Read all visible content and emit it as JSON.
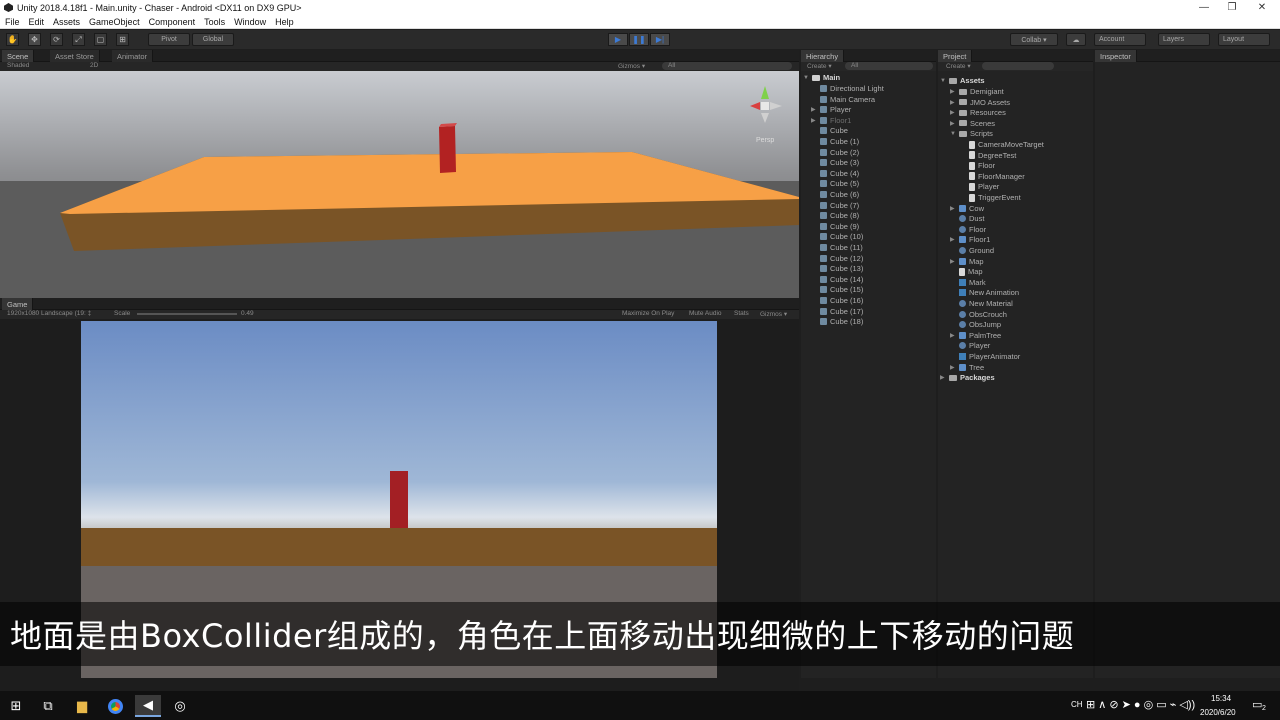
{
  "window": {
    "title": "Unity 2018.4.18f1 - Main.unity - Chaser - Android <DX11 on DX9 GPU>",
    "minimize": "—",
    "maximize": "❐",
    "close": "✕"
  },
  "menu": [
    "File",
    "Edit",
    "Assets",
    "GameObject",
    "Component",
    "Tools",
    "Window",
    "Help"
  ],
  "toolbar": {
    "pivot": "Pivot",
    "global": "Global",
    "collab": "Collab ▾",
    "account": "Account",
    "layers": "Layers",
    "layout": "Layout"
  },
  "scene": {
    "tabs": [
      "Scene",
      "Asset Store",
      "Animator"
    ],
    "shading": "Shaded",
    "mode2d": "2D",
    "gizmos": "Gizmos ▾",
    "search": "All",
    "persp": "Persp"
  },
  "game": {
    "tab": "Game",
    "resolution": "1920x1080 Landscape (19: ‡",
    "scale_label": "Scale",
    "scale_value": "0.49",
    "maximize": "Maximize On Play",
    "mute": "Mute Audio",
    "stats": "Stats",
    "gizmos": "Gizmos ▾"
  },
  "hierarchy": {
    "tab": "Hierarchy",
    "create": "Create ▾",
    "search": "All",
    "scene": "Main",
    "items": [
      "Directional Light",
      "Main Camera",
      "Player",
      "Floor1",
      "Cube",
      "Cube (1)",
      "Cube (2)",
      "Cube (3)",
      "Cube (4)",
      "Cube (5)",
      "Cube (6)",
      "Cube (7)",
      "Cube (8)",
      "Cube (9)",
      "Cube (10)",
      "Cube (11)",
      "Cube (12)",
      "Cube (13)",
      "Cube (14)",
      "Cube (15)",
      "Cube (16)",
      "Cube (17)",
      "Cube (18)"
    ]
  },
  "project": {
    "tab": "Project",
    "create": "Create ▾",
    "root": "Assets",
    "folders": [
      "Demigiant",
      "JMO Assets",
      "Resources",
      "Scenes",
      "Scripts"
    ],
    "scripts": [
      "CameraMoveTarget",
      "DegreeTest",
      "Floor",
      "FloorManager",
      "Player",
      "TriggerEvent"
    ],
    "assets": [
      "Cow",
      "Dust",
      "Floor",
      "Floor1",
      "Ground",
      "Map",
      "Map",
      "Mark",
      "New Animation",
      "New Material",
      "ObsCrouch",
      "ObsJump",
      "PalmTree",
      "Player",
      "PlayerAnimator",
      "Tree"
    ],
    "packages": "Packages"
  },
  "inspector": {
    "tab": "Inspector"
  },
  "subtitle": "地面是由BoxCollider组成的，角色在上面移动出现细微的上下移动的问题",
  "taskbar": {
    "time": "15:34",
    "date": "2020/6/20",
    "ime": "CH",
    "notif": "2"
  },
  "colors": {
    "floor_top": "#f7a046",
    "floor_side": "#7a5426",
    "cube_red": "#b22222",
    "sky_top": "#6b8cc4",
    "horizon": "#dde3ea"
  }
}
